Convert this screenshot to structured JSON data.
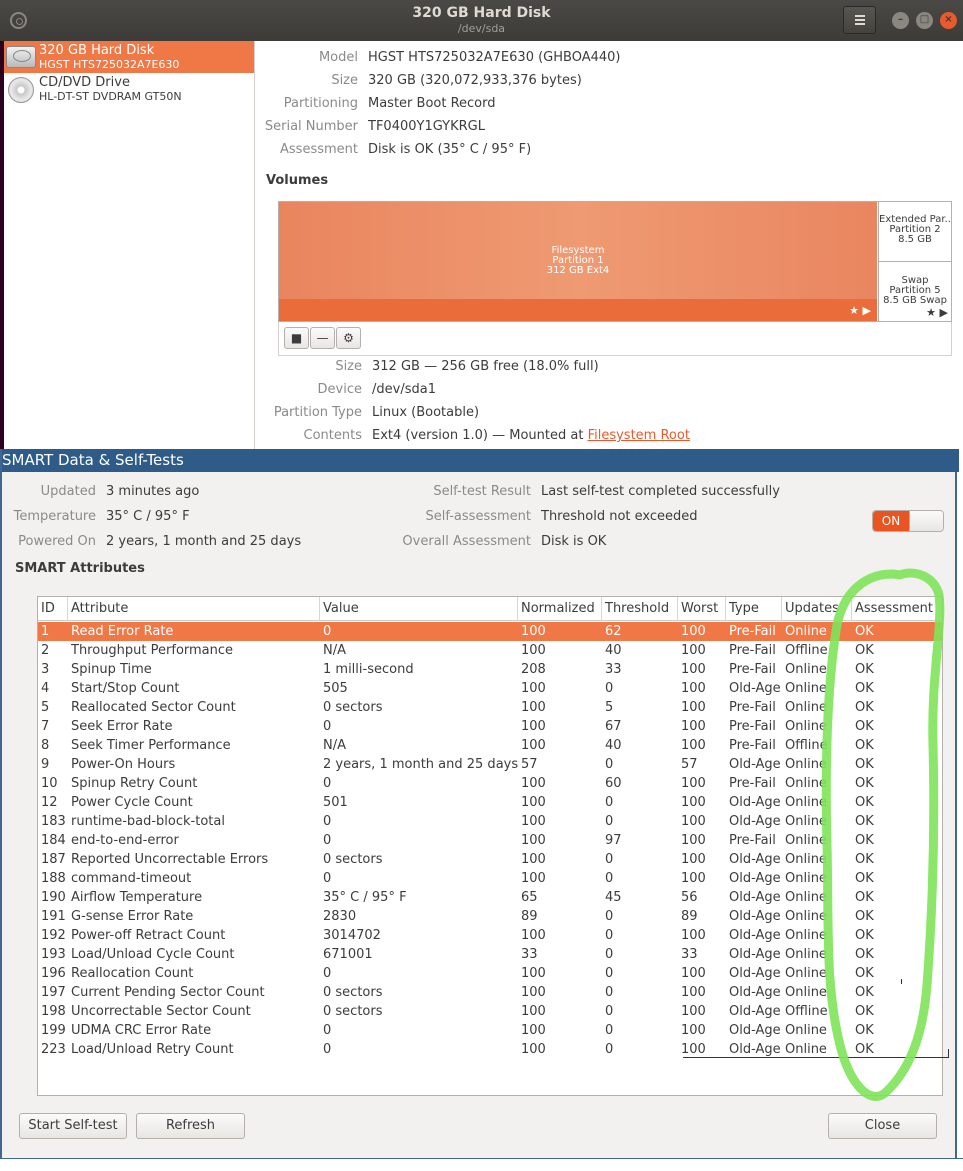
{
  "window": {
    "title": "320 GB Hard Disk",
    "subtitle": "/dev/sda"
  },
  "drives": [
    {
      "name": "320 GB Hard Disk",
      "model": "HGST HTS725032A7E630"
    },
    {
      "name": "CD/DVD Drive",
      "model": "HL-DT-ST DVDRAM GT50N"
    }
  ],
  "disk": {
    "labels": {
      "model": "Model",
      "size": "Size",
      "partitioning": "Partitioning",
      "serial": "Serial Number",
      "assessment": "Assessment"
    },
    "model": "HGST HTS725032A7E630 (GHBOA440)",
    "size": "320 GB (320,072,933,376 bytes)",
    "partitioning": "Master Boot Record",
    "serial": "TF0400Y1GYKRGL",
    "assessment": "Disk is OK (35° C / 95° F)"
  },
  "volumes": {
    "heading": "Volumes",
    "p1": [
      "Filesystem",
      "Partition 1",
      "312 GB Ext4"
    ],
    "ext": [
      "Extended Par...",
      "Partition 2",
      "8.5 GB"
    ],
    "swap": [
      "Swap",
      "Partition 5",
      "8.5 GB Swap"
    ],
    "marks": "★ ▶"
  },
  "partition": {
    "labels": {
      "size": "Size",
      "device": "Device",
      "type": "Partition Type",
      "contents": "Contents"
    },
    "size": "312 GB — 256 GB free (18.0% full)",
    "device": "/dev/sda1",
    "type": "Linux (Bootable)",
    "contents_prefix": "Ext4 (version 1.0) — Mounted at",
    "contents_link": "Filesystem Root"
  },
  "smart": {
    "title": "SMART Data & Self-Tests",
    "labels": {
      "updated": "Updated",
      "temperature": "Temperature",
      "powered_on": "Powered On",
      "self_test": "Self-test Result",
      "self_assessment": "Self-assessment",
      "overall": "Overall Assessment"
    },
    "updated": "3 minutes ago",
    "temperature": "35° C / 95° F",
    "powered_on": "2 years, 1 month and 25 days",
    "self_test": "Last self-test completed successfully",
    "self_assessment": "Threshold not exceeded",
    "overall": "Disk is OK",
    "toggle_label": "ON",
    "attributes_heading": "SMART Attributes",
    "columns": [
      "ID",
      "Attribute",
      "Value",
      "Normalized",
      "Threshold",
      "Worst",
      "Type",
      "Updates",
      "Assessment"
    ],
    "rows": [
      [
        "1",
        "Read Error Rate",
        "0",
        "100",
        "62",
        "100",
        "Pre-Fail",
        "Online",
        "OK"
      ],
      [
        "2",
        "Throughput Performance",
        "N/A",
        "100",
        "40",
        "100",
        "Pre-Fail",
        "Offline",
        "OK"
      ],
      [
        "3",
        "Spinup Time",
        "1 milli-second",
        "208",
        "33",
        "100",
        "Pre-Fail",
        "Online",
        "OK"
      ],
      [
        "4",
        "Start/Stop Count",
        "505",
        "100",
        "0",
        "100",
        "Old-Age",
        "Online",
        "OK"
      ],
      [
        "5",
        "Reallocated Sector Count",
        "0 sectors",
        "100",
        "5",
        "100",
        "Pre-Fail",
        "Online",
        "OK"
      ],
      [
        "7",
        "Seek Error Rate",
        "0",
        "100",
        "67",
        "100",
        "Pre-Fail",
        "Online",
        "OK"
      ],
      [
        "8",
        "Seek Timer Performance",
        "N/A",
        "100",
        "40",
        "100",
        "Pre-Fail",
        "Offline",
        "OK"
      ],
      [
        "9",
        "Power-On Hours",
        "2 years, 1 month and 25 days",
        "57",
        "0",
        "57",
        "Old-Age",
        "Online",
        "OK"
      ],
      [
        "10",
        "Spinup Retry Count",
        "0",
        "100",
        "60",
        "100",
        "Pre-Fail",
        "Online",
        "OK"
      ],
      [
        "12",
        "Power Cycle Count",
        "501",
        "100",
        "0",
        "100",
        "Old-Age",
        "Online",
        "OK"
      ],
      [
        "183",
        "runtime-bad-block-total",
        "0",
        "100",
        "0",
        "100",
        "Old-Age",
        "Online",
        "OK"
      ],
      [
        "184",
        "end-to-end-error",
        "0",
        "100",
        "97",
        "100",
        "Pre-Fail",
        "Online",
        "OK"
      ],
      [
        "187",
        "Reported Uncorrectable Errors",
        "0 sectors",
        "100",
        "0",
        "100",
        "Old-Age",
        "Online",
        "OK"
      ],
      [
        "188",
        "command-timeout",
        "0",
        "100",
        "0",
        "100",
        "Old-Age",
        "Online",
        "OK"
      ],
      [
        "190",
        "Airflow Temperature",
        "35° C / 95° F",
        "65",
        "45",
        "56",
        "Old-Age",
        "Online",
        "OK"
      ],
      [
        "191",
        "G-sense Error Rate",
        "2830",
        "89",
        "0",
        "89",
        "Old-Age",
        "Online",
        "OK"
      ],
      [
        "192",
        "Power-off Retract Count",
        "3014702",
        "100",
        "0",
        "100",
        "Old-Age",
        "Online",
        "OK"
      ],
      [
        "193",
        "Load/Unload Cycle Count",
        "671001",
        "33",
        "0",
        "33",
        "Old-Age",
        "Online",
        "OK"
      ],
      [
        "196",
        "Reallocation Count",
        "0",
        "100",
        "0",
        "100",
        "Old-Age",
        "Online",
        "OK"
      ],
      [
        "197",
        "Current Pending Sector Count",
        "0 sectors",
        "100",
        "0",
        "100",
        "Old-Age",
        "Online",
        "OK"
      ],
      [
        "198",
        "Uncorrectable Sector Count",
        "0 sectors",
        "100",
        "0",
        "100",
        "Old-Age",
        "Offline",
        "OK"
      ],
      [
        "199",
        "UDMA CRC Error Rate",
        "0",
        "100",
        "0",
        "100",
        "Old-Age",
        "Online",
        "OK"
      ],
      [
        "223",
        "Load/Unload Retry Count",
        "0",
        "100",
        "0",
        "100",
        "Old-Age",
        "Online",
        "OK"
      ]
    ],
    "buttons": {
      "start": "Start Self-test",
      "refresh": "Refresh",
      "close": "Close"
    }
  },
  "colors": {
    "accent": "#f07746",
    "dialog_title": "#2e5b87",
    "annotation": "#7ee35a"
  },
  "icons": {
    "app": "disks-icon",
    "menu": "hamburger-menu-icon",
    "hdd": "hard-disk-icon",
    "cd": "optical-disc-icon",
    "stop": "stop-icon",
    "remove": "minus-icon",
    "settings": "gears-icon"
  }
}
